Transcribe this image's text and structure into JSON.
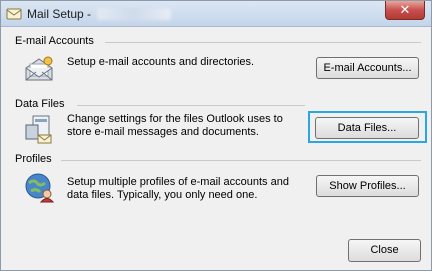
{
  "window": {
    "title": "Mail Setup -"
  },
  "sections": {
    "email": {
      "heading": "E-mail Accounts",
      "description": "Setup e-mail accounts and directories.",
      "button_label": "E-mail Accounts...",
      "icon": "email-accounts-icon"
    },
    "data_files": {
      "heading": "Data Files",
      "description_line1": "Change settings for the files Outlook uses to",
      "description_line2": "store e-mail messages and documents.",
      "button_label": "Data Files...",
      "icon": "data-files-icon"
    },
    "profiles": {
      "heading": "Profiles",
      "description_line1": "Setup multiple profiles of e-mail accounts and",
      "description_line2": "data files. Typically, you only need one.",
      "button_label": "Show Profiles...",
      "icon": "profiles-icon"
    }
  },
  "footer": {
    "close_label": "Close"
  },
  "colors": {
    "focus_highlight": "#2aa7e0",
    "close_button": "#c75050"
  }
}
